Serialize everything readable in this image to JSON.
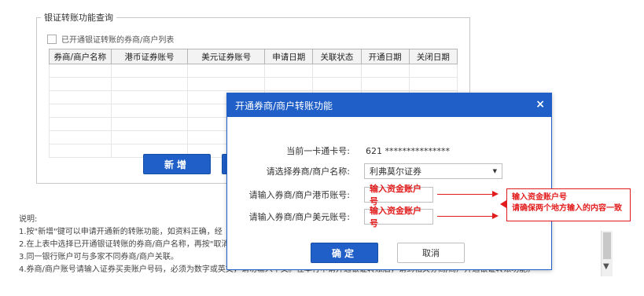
{
  "section": {
    "legend": "银证转账功能查询",
    "checkbox_label": "已开通银证转账的券商/商户列表",
    "columns": [
      "券商/商户名称",
      "港币证券账号",
      "美元证券账号",
      "申请日期",
      "关联状态",
      "开通日期",
      "关闭日期"
    ],
    "new_button": "新增"
  },
  "notes": {
    "title": "说明:",
    "lines": [
      "1.按\"新增\"键可以申请开通新的转账功能，如资料正确，经",
      "2.在上表中选择已开通银证转账的券商/商户名称，再按\"取消",
      "3.同一银行账户可与多家不同券商/商户关联。",
      "4.券商/商户账号请输入证券买卖账户号码，必须为数字或英文，请勿输入中文。在本行申请开通银证转账后，请到相关券商/商户开通银证转账功能。"
    ]
  },
  "modal": {
    "title": "开通券商/商户转账功能",
    "close_icon": "×",
    "card_label": "当前一卡通卡号:",
    "card_value": "621 ***************",
    "broker_label": "请选择券商/商户名称:",
    "broker_value": "利弗莫尔证券",
    "hkd_label": "请输入券商/商户港币账号:",
    "hkd_value": "输入资金账户号",
    "usd_label": "请输入券商/商户美元账号:",
    "usd_value": "输入资金账户号",
    "ok_button": "确定",
    "cancel_button": "取消"
  },
  "annotation": {
    "line1": "输入资金账户号",
    "line2": "请确保两个地方输入的内容一致"
  },
  "colors": {
    "accent": "#1f5fc7",
    "annotation": "#e21c1c"
  }
}
